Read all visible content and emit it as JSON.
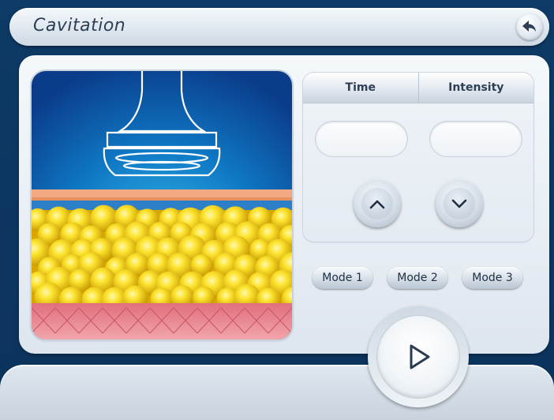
{
  "header": {
    "title": "Cavitation"
  },
  "controls": {
    "tabs": [
      {
        "label": "Time"
      },
      {
        "label": "Intensity"
      }
    ],
    "time_value": "",
    "intensity_value": ""
  },
  "modes": [
    {
      "label": "Mode 1"
    },
    {
      "label": "Mode 2"
    },
    {
      "label": "Mode 3"
    }
  ],
  "icons": {
    "back": "back-arrow-icon",
    "up": "chevron-up-icon",
    "down": "chevron-down-icon",
    "play": "play-icon",
    "illustration": "ultrasound-probe-fat-layer-illustration"
  },
  "colors": {
    "background": "#0d3a66",
    "panel": "#e8eef4",
    "text": "#2e3f55",
    "fat": "#f5c90f",
    "skin": "#f0a07a",
    "muscle": "#e0707a"
  }
}
